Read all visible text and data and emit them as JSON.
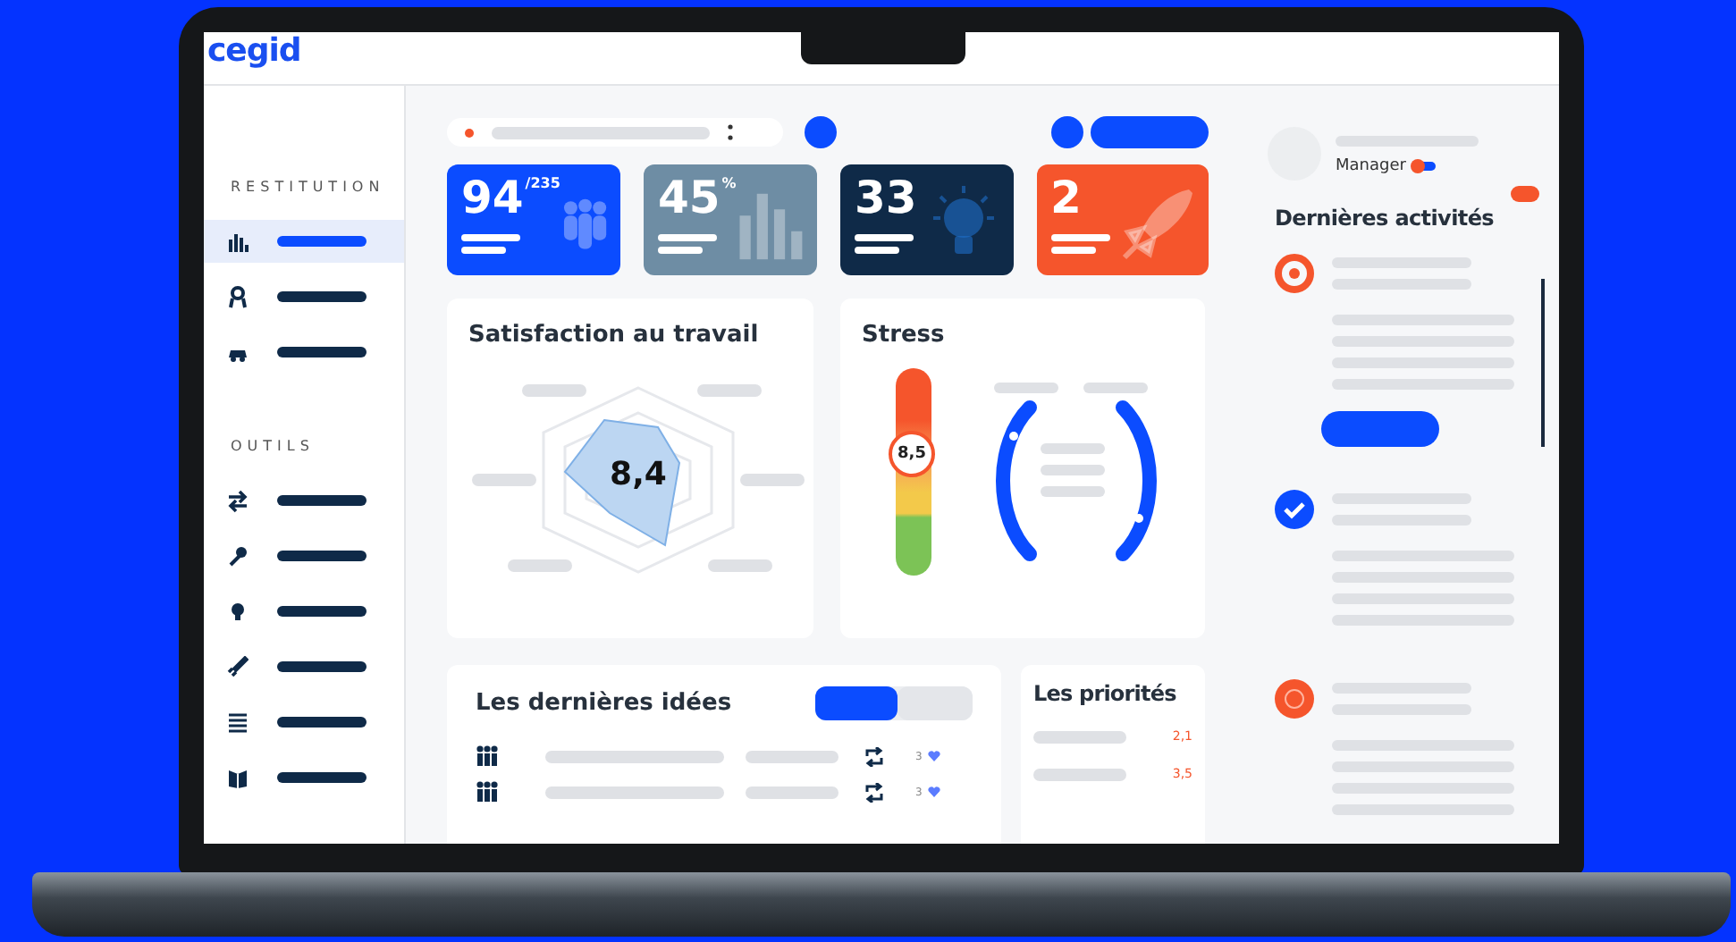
{
  "logo": "cegid",
  "sidebar": {
    "sections": [
      {
        "title": "RESTITUTION",
        "items": [
          {
            "selected": true
          },
          {
            "selected": false
          },
          {
            "selected": false
          }
        ]
      },
      {
        "title": "OUTILS",
        "items": [
          {
            "selected": false
          },
          {
            "selected": false
          },
          {
            "selected": false
          },
          {
            "selected": false
          },
          {
            "selected": false
          },
          {
            "selected": false
          }
        ]
      }
    ]
  },
  "kpis": [
    {
      "value": "94",
      "unit": "/235",
      "color": "#0b4cff"
    },
    {
      "value": "45",
      "unit": "%",
      "color": "#6e8da4"
    },
    {
      "value": "33",
      "color": "#0f2a48"
    },
    {
      "value": "2",
      "color": "#f5552c"
    }
  ],
  "satisfaction": {
    "title": "Satisfaction au travail",
    "score": "8,4"
  },
  "stress": {
    "title": "Stress",
    "score": "8,5",
    "level": 0.59
  },
  "ideas": {
    "title": "Les dernières idées",
    "segments": [
      {
        "selected": true
      },
      {
        "selected": false
      }
    ],
    "rows": [
      {
        "likes": "3"
      },
      {
        "likes": "3"
      }
    ]
  },
  "priorities": {
    "title": "Les priorités",
    "rows": [
      {
        "value": "2,1"
      },
      {
        "value": "3,5"
      }
    ]
  },
  "profile": {
    "role": "Manager"
  },
  "activities": {
    "title": "Dernières activités",
    "items": [
      {
        "kind": "ring"
      },
      {
        "kind": "check"
      },
      {
        "kind": "smiley"
      }
    ]
  }
}
